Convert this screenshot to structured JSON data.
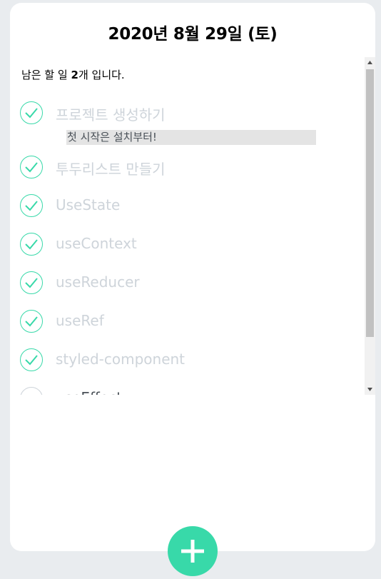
{
  "header": {
    "date": "2020년 8월 29일 (토)",
    "remaining_prefix": "남은 할 일 ",
    "remaining_count": "2",
    "remaining_suffix": "개 입니다."
  },
  "todos": [
    {
      "text": "프로젝트 생성하기",
      "done": true,
      "memo": "첫 시작은 설치부터!"
    },
    {
      "text": "투두리스트 만들기",
      "done": true
    },
    {
      "text": "UseState",
      "done": true
    },
    {
      "text": "useContext",
      "done": true
    },
    {
      "text": "useReducer",
      "done": true
    },
    {
      "text": "useRef",
      "done": true
    },
    {
      "text": "styled-component",
      "done": true
    },
    {
      "text": "useEffect",
      "done": false
    }
  ],
  "icons": {
    "check": "check-icon",
    "add": "plus-icon",
    "scroll_up": "triangle-up-icon",
    "scroll_down": "triangle-down-icon"
  },
  "colors": {
    "accent": "#38d9a9",
    "done_text": "#ced4da",
    "memo_bg": "#e4e4e4"
  }
}
